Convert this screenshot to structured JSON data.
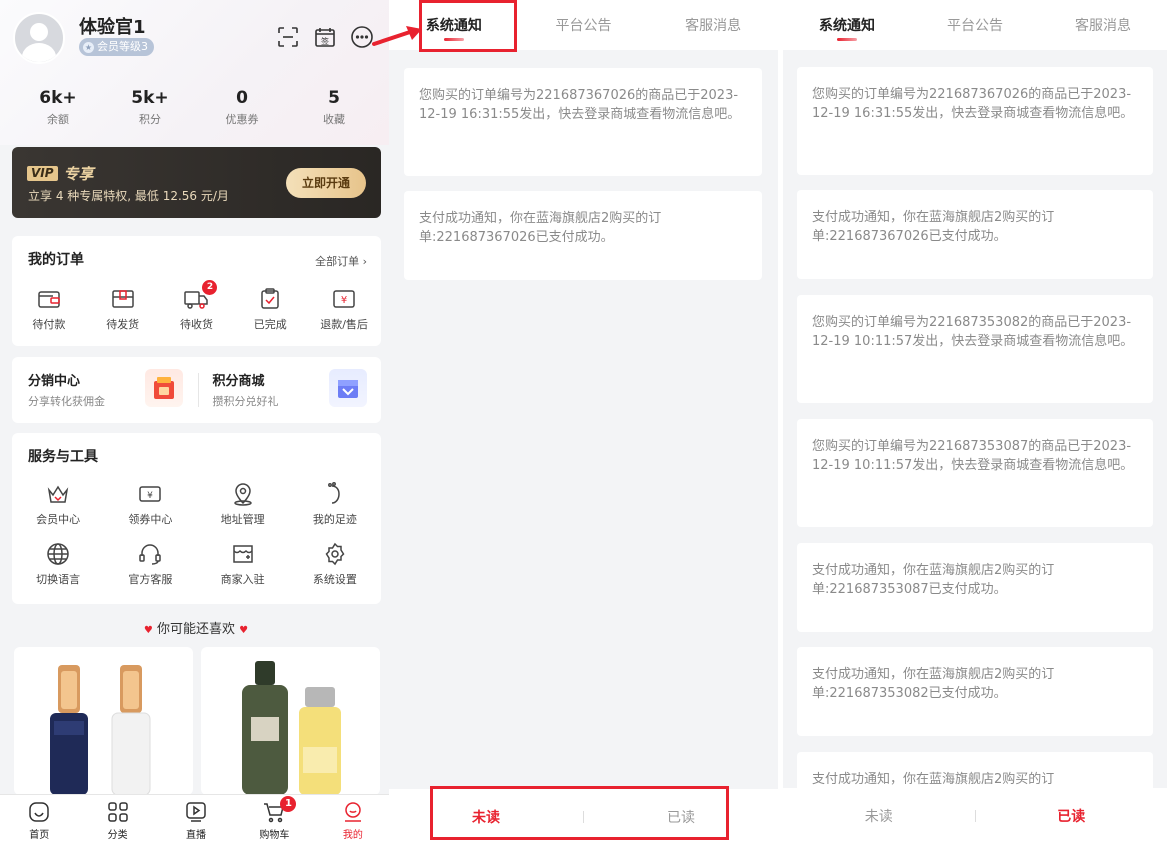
{
  "profile": {
    "username": "体验官1",
    "level": "会员等级3",
    "stats": [
      {
        "value": "6k+",
        "label": "余额"
      },
      {
        "value": "5k+",
        "label": "积分"
      },
      {
        "value": "0",
        "label": "优惠券"
      },
      {
        "value": "5",
        "label": "收藏"
      }
    ],
    "vip": {
      "logo": "VIP",
      "title": "专享",
      "desc": "立享 4 种专属特权, 最低 12.56 元/月",
      "button": "立即开通"
    },
    "orders": {
      "title": "我的订单",
      "all_link": "全部订单",
      "items": [
        {
          "label": "待付款",
          "icon": "wallet-icon"
        },
        {
          "label": "待发货",
          "icon": "box-icon"
        },
        {
          "label": "待收货",
          "icon": "truck-icon",
          "badge": "2"
        },
        {
          "label": "已完成",
          "icon": "clipboard-check-icon"
        },
        {
          "label": "退款/售后",
          "icon": "refund-icon"
        }
      ]
    },
    "promo": [
      {
        "title": "分销中心",
        "sub": "分享转化获佣金",
        "icon": "distribution-icon"
      },
      {
        "title": "积分商城",
        "sub": "攒积分兑好礼",
        "icon": "points-mall-icon"
      }
    ],
    "services": {
      "title": "服务与工具",
      "items": [
        {
          "label": "会员中心",
          "icon": "crown-icon"
        },
        {
          "label": "领券中心",
          "icon": "coupon-icon"
        },
        {
          "label": "地址管理",
          "icon": "location-icon"
        },
        {
          "label": "我的足迹",
          "icon": "footprint-icon"
        },
        {
          "label": "切换语言",
          "icon": "globe-icon"
        },
        {
          "label": "官方客服",
          "icon": "headset-icon"
        },
        {
          "label": "商家入驻",
          "icon": "store-icon"
        },
        {
          "label": "系统设置",
          "icon": "gear-icon"
        }
      ]
    },
    "maybe_like": "你可能还喜欢",
    "tabbar": [
      {
        "label": "首页",
        "icon": "home-icon"
      },
      {
        "label": "分类",
        "icon": "category-icon"
      },
      {
        "label": "直播",
        "icon": "live-icon"
      },
      {
        "label": "购物车",
        "icon": "cart-icon",
        "badge": "1"
      },
      {
        "label": "我的",
        "icon": "mine-icon",
        "active": true
      }
    ]
  },
  "messages_left": {
    "tabs": [
      "系统通知",
      "平台公告",
      "客服消息"
    ],
    "active_tab": 0,
    "cards": [
      "您购买的订单编号为221687367026的商品已于2023-12-19 16:31:55发出，快去登录商城查看物流信息吧。",
      "支付成功通知，你在蓝海旗舰店2购买的订单:221687367026已支付成功。"
    ],
    "bottom": {
      "unread": "未读",
      "read": "已读",
      "active": "unread"
    }
  },
  "messages_right": {
    "tabs": [
      "系统通知",
      "平台公告",
      "客服消息"
    ],
    "active_tab": 0,
    "cards": [
      "您购买的订单编号为221687367026的商品已于2023-12-19 16:31:55发出，快去登录商城查看物流信息吧。",
      "支付成功通知，你在蓝海旗舰店2购买的订单:221687367026已支付成功。",
      "您购买的订单编号为221687353082的商品已于2023-12-19 10:11:57发出，快去登录商城查看物流信息吧。",
      "您购买的订单编号为221687353087的商品已于2023-12-19 10:11:57发出，快去登录商城查看物流信息吧。",
      "支付成功通知，你在蓝海旗舰店2购买的订单:221687353087已支付成功。",
      "支付成功通知，你在蓝海旗舰店2购买的订单:221687353082已支付成功。",
      "支付成功通知，你在蓝海旗舰店2购买的订"
    ],
    "bottom": {
      "unread": "未读",
      "read": "已读",
      "active": "read"
    }
  },
  "colors": {
    "accent": "#e8222f",
    "vip_gold": "#e6c68c",
    "bg": "#f3f4f6"
  }
}
